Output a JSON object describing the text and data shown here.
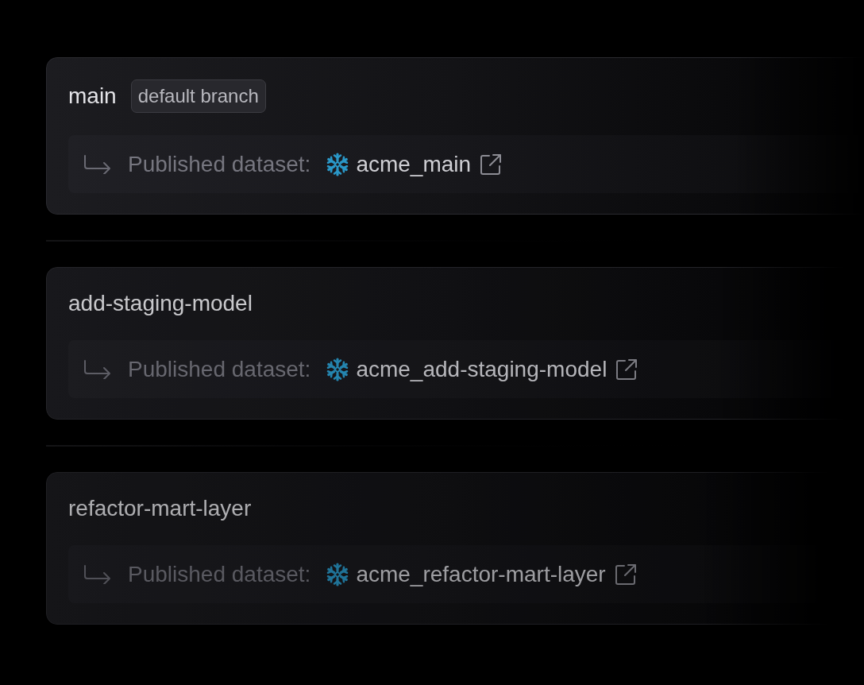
{
  "branches": [
    {
      "name": "main",
      "badge": "default branch",
      "dataset_label": "Published dataset:",
      "dataset": "acme_main"
    },
    {
      "name": "add-staging-model",
      "dataset_label": "Published dataset:",
      "dataset": "acme_add-staging-model"
    },
    {
      "name": "refactor-mart-layer",
      "dataset_label": "Published dataset:",
      "dataset": "acme_refactor-mart-layer"
    }
  ]
}
